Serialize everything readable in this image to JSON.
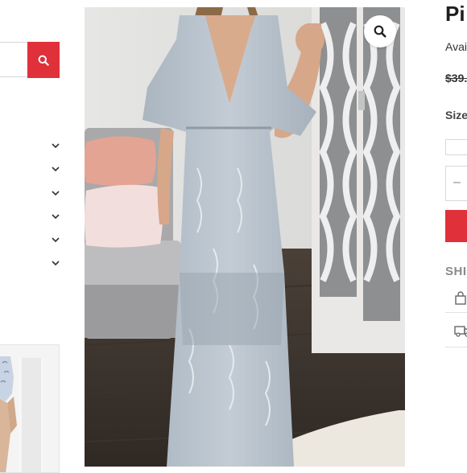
{
  "search": {
    "placeholder": "",
    "button_icon": "search-icon",
    "accent_color": "#e0303a"
  },
  "sidebar": {
    "filters": [
      {
        "icon": "chevron-down-icon"
      },
      {
        "icon": "chevron-down-icon"
      },
      {
        "icon": "chevron-down-icon"
      },
      {
        "icon": "chevron-down-icon"
      },
      {
        "icon": "chevron-down-icon"
      },
      {
        "icon": "chevron-down-icon"
      }
    ]
  },
  "gallery": {
    "zoom_icon": "search-icon"
  },
  "product": {
    "title": "Pi",
    "availability": "Avai",
    "price": "$39.",
    "size_label": "Size",
    "qty_minus": "–",
    "shipping_label": "SHI",
    "add_to_cart_color": "#e0303a",
    "shipping_icons": [
      "shopping-bag-icon",
      "truck-icon"
    ]
  }
}
